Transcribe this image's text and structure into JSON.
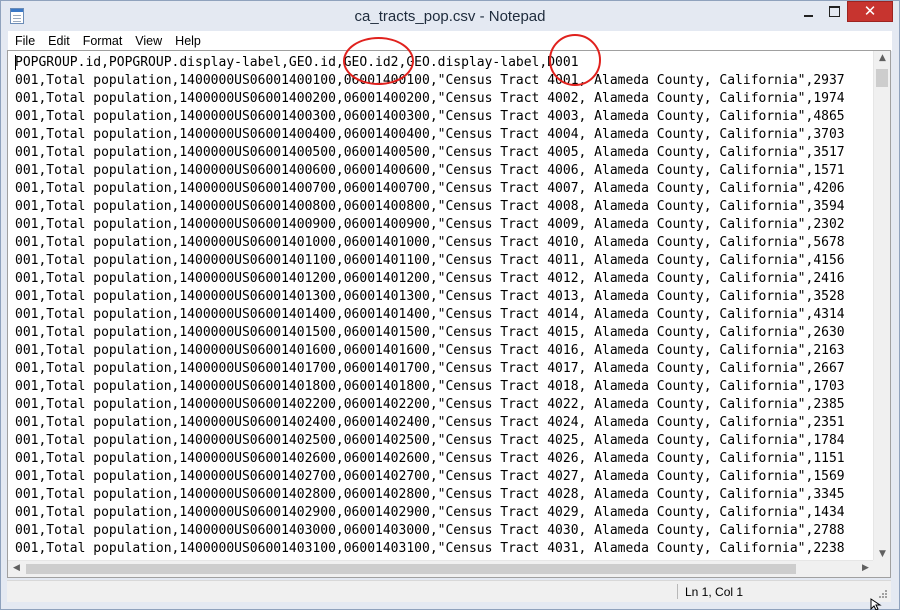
{
  "window": {
    "title": "ca_tracts_pop.csv - Notepad",
    "controls": {
      "minimize": "minimize-icon",
      "maximize": "maximize-icon",
      "close": "close-icon",
      "close_color": "#c7342f"
    }
  },
  "menu": [
    "File",
    "Edit",
    "Format",
    "View",
    "Help"
  ],
  "document": {
    "header": "POPGROUP.id,POPGROUP.display-label,GEO.id,GEO.id2,GEO.display-label,D001",
    "rows": [
      "001,Total population,1400000US06001400100,06001400100,\"Census Tract 4001, Alameda County, California\",2937",
      "001,Total population,1400000US06001400200,06001400200,\"Census Tract 4002, Alameda County, California\",1974",
      "001,Total population,1400000US06001400300,06001400300,\"Census Tract 4003, Alameda County, California\",4865",
      "001,Total population,1400000US06001400400,06001400400,\"Census Tract 4004, Alameda County, California\",3703",
      "001,Total population,1400000US06001400500,06001400500,\"Census Tract 4005, Alameda County, California\",3517",
      "001,Total population,1400000US06001400600,06001400600,\"Census Tract 4006, Alameda County, California\",1571",
      "001,Total population,1400000US06001400700,06001400700,\"Census Tract 4007, Alameda County, California\",4206",
      "001,Total population,1400000US06001400800,06001400800,\"Census Tract 4008, Alameda County, California\",3594",
      "001,Total population,1400000US06001400900,06001400900,\"Census Tract 4009, Alameda County, California\",2302",
      "001,Total population,1400000US06001401000,06001401000,\"Census Tract 4010, Alameda County, California\",5678",
      "001,Total population,1400000US06001401100,06001401100,\"Census Tract 4011, Alameda County, California\",4156",
      "001,Total population,1400000US06001401200,06001401200,\"Census Tract 4012, Alameda County, California\",2416",
      "001,Total population,1400000US06001401300,06001401300,\"Census Tract 4013, Alameda County, California\",3528",
      "001,Total population,1400000US06001401400,06001401400,\"Census Tract 4014, Alameda County, California\",4314",
      "001,Total population,1400000US06001401500,06001401500,\"Census Tract 4015, Alameda County, California\",2630",
      "001,Total population,1400000US06001401600,06001401600,\"Census Tract 4016, Alameda County, California\",2163",
      "001,Total population,1400000US06001401700,06001401700,\"Census Tract 4017, Alameda County, California\",2667",
      "001,Total population,1400000US06001401800,06001401800,\"Census Tract 4018, Alameda County, California\",1703",
      "001,Total population,1400000US06001402200,06001402200,\"Census Tract 4022, Alameda County, California\",2385",
      "001,Total population,1400000US06001402400,06001402400,\"Census Tract 4024, Alameda County, California\",2351",
      "001,Total population,1400000US06001402500,06001402500,\"Census Tract 4025, Alameda County, California\",1784",
      "001,Total population,1400000US06001402600,06001402600,\"Census Tract 4026, Alameda County, California\",1151",
      "001,Total population,1400000US06001402700,06001402700,\"Census Tract 4027, Alameda County, California\",1569",
      "001,Total population,1400000US06001402800,06001402800,\"Census Tract 4028, Alameda County, California\",3345",
      "001,Total population,1400000US06001402900,06001402900,\"Census Tract 4029, Alameda County, California\",1434",
      "001,Total population,1400000US06001403000,06001403000,\"Census Tract 4030, Alameda County, California\",2788",
      "001,Total population,1400000US06001403100,06001403100,\"Census Tract 4031, Alameda County, California\",2238"
    ]
  },
  "annotations": {
    "highlighted_columns": [
      "GEO.id2",
      "D001"
    ],
    "color": "#e0211d"
  },
  "status": {
    "position": "Ln 1, Col 1"
  }
}
